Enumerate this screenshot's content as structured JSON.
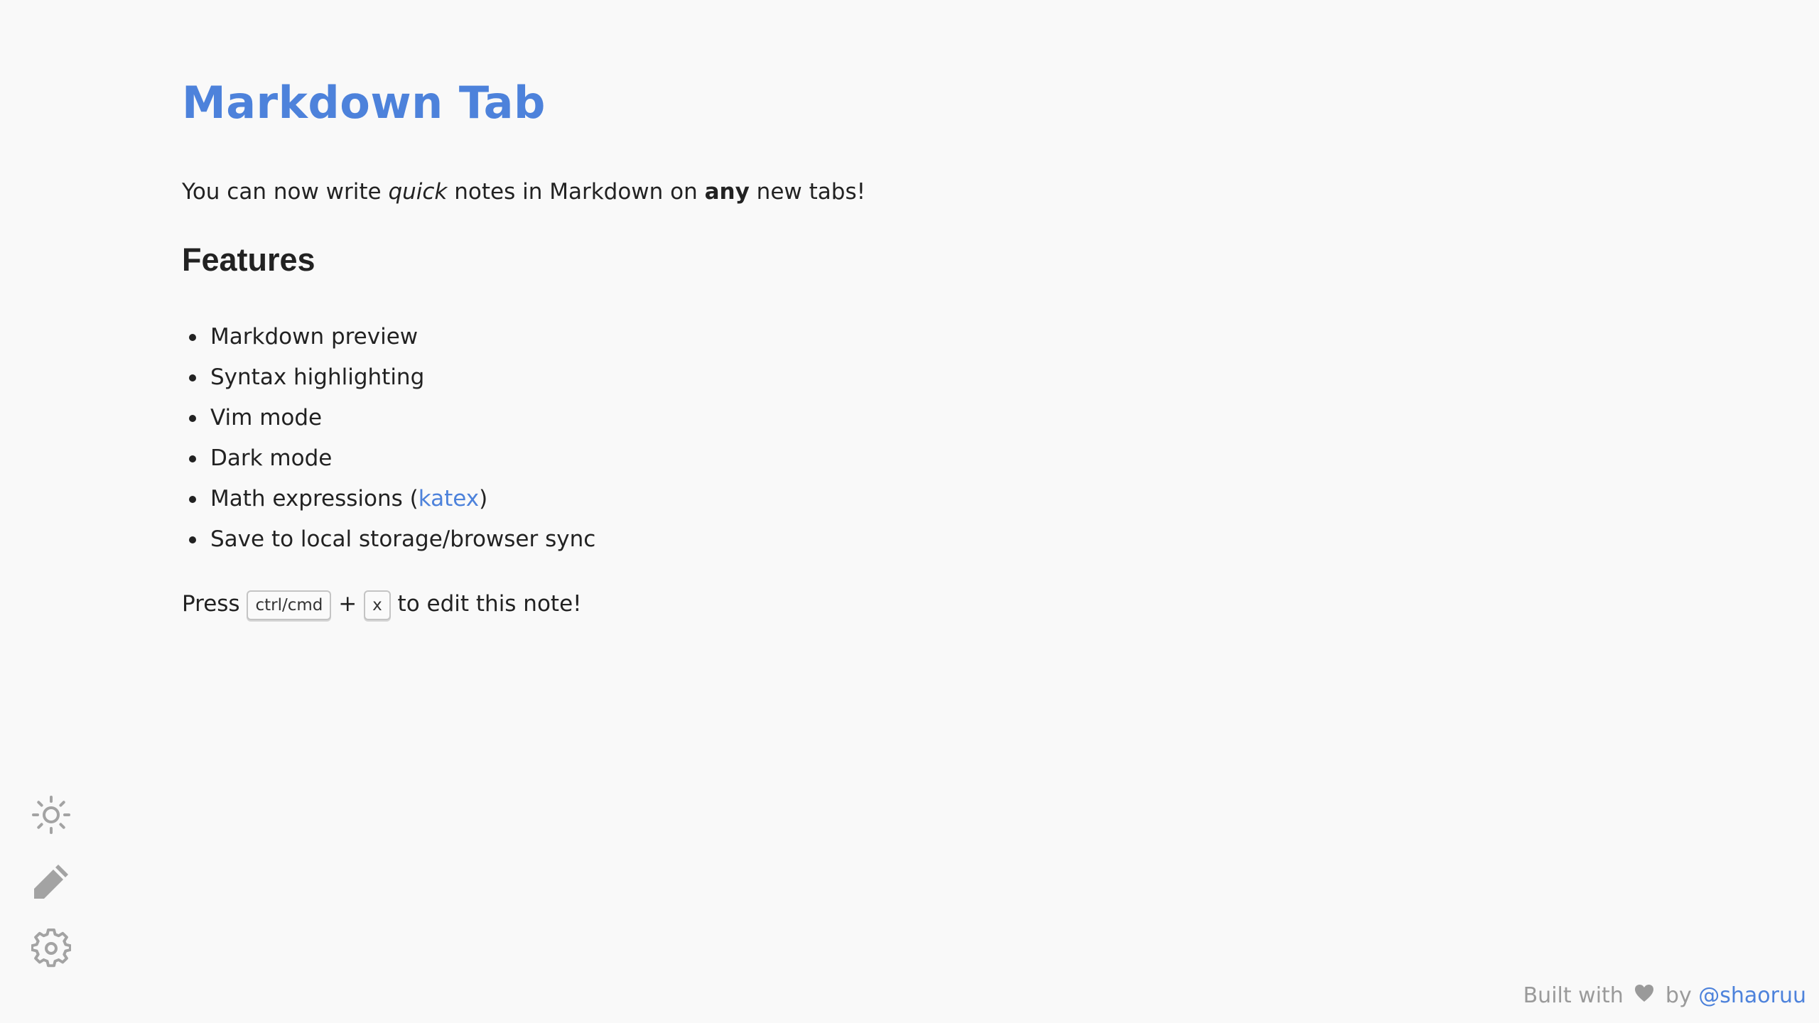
{
  "note": {
    "title": "Markdown Tab",
    "intro": {
      "part1": "You can now write ",
      "italic": "quick",
      "part2": " notes in Markdown on ",
      "bold": "any",
      "part3": " new tabs!"
    },
    "features_heading": "Features",
    "features": [
      "Markdown preview",
      "Syntax highlighting",
      "Vim mode",
      "Dark mode",
      "Math expressions (",
      "Save to local storage/browser sync"
    ],
    "math_link": "katex",
    "math_close": ")",
    "press": {
      "prefix": "Press ",
      "key1": "ctrl/cmd",
      "plus": " + ",
      "key2": "x",
      "suffix": " to edit this note!"
    }
  },
  "sidebar": {
    "icons": [
      "sun-icon",
      "pencil-icon",
      "gear-icon"
    ]
  },
  "footer": {
    "prefix": "Built with",
    "heart_icon": "heart-icon",
    "by": "by",
    "author": "@shaoruu"
  },
  "colors": {
    "accent": "#4d82db",
    "background": "#f9f9f9",
    "text": "#222222",
    "muted": "#9a9a9a"
  }
}
